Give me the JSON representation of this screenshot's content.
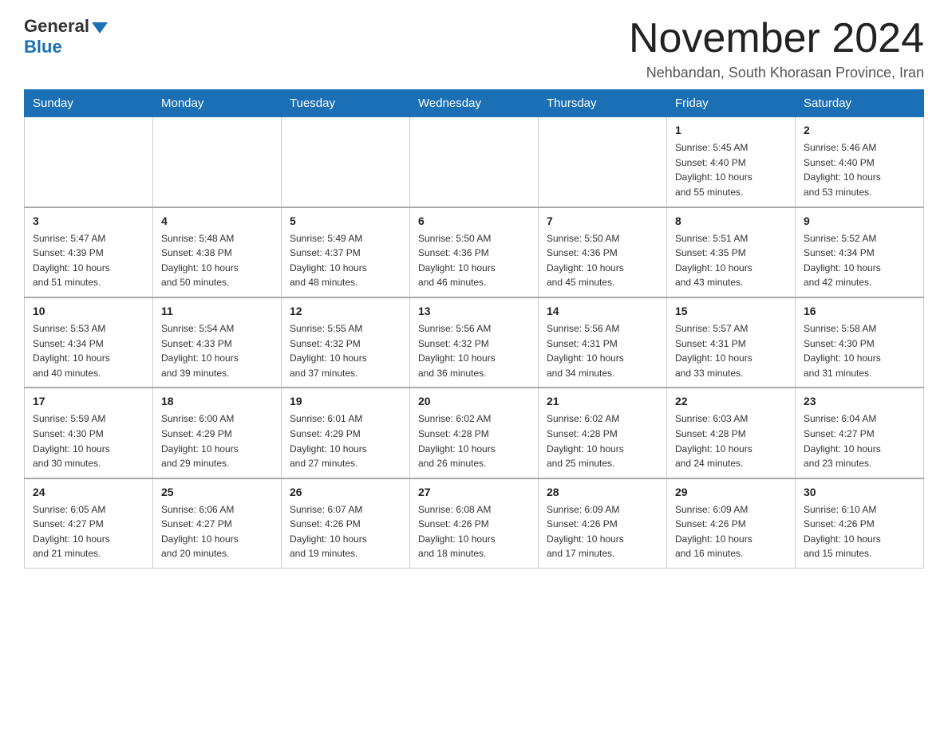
{
  "logo": {
    "general": "General",
    "blue": "Blue"
  },
  "title": "November 2024",
  "location": "Nehbandan, South Khorasan Province, Iran",
  "days_header": [
    "Sunday",
    "Monday",
    "Tuesday",
    "Wednesday",
    "Thursday",
    "Friday",
    "Saturday"
  ],
  "weeks": [
    [
      {
        "day": "",
        "info": ""
      },
      {
        "day": "",
        "info": ""
      },
      {
        "day": "",
        "info": ""
      },
      {
        "day": "",
        "info": ""
      },
      {
        "day": "",
        "info": ""
      },
      {
        "day": "1",
        "info": "Sunrise: 5:45 AM\nSunset: 4:40 PM\nDaylight: 10 hours\nand 55 minutes."
      },
      {
        "day": "2",
        "info": "Sunrise: 5:46 AM\nSunset: 4:40 PM\nDaylight: 10 hours\nand 53 minutes."
      }
    ],
    [
      {
        "day": "3",
        "info": "Sunrise: 5:47 AM\nSunset: 4:39 PM\nDaylight: 10 hours\nand 51 minutes."
      },
      {
        "day": "4",
        "info": "Sunrise: 5:48 AM\nSunset: 4:38 PM\nDaylight: 10 hours\nand 50 minutes."
      },
      {
        "day": "5",
        "info": "Sunrise: 5:49 AM\nSunset: 4:37 PM\nDaylight: 10 hours\nand 48 minutes."
      },
      {
        "day": "6",
        "info": "Sunrise: 5:50 AM\nSunset: 4:36 PM\nDaylight: 10 hours\nand 46 minutes."
      },
      {
        "day": "7",
        "info": "Sunrise: 5:50 AM\nSunset: 4:36 PM\nDaylight: 10 hours\nand 45 minutes."
      },
      {
        "day": "8",
        "info": "Sunrise: 5:51 AM\nSunset: 4:35 PM\nDaylight: 10 hours\nand 43 minutes."
      },
      {
        "day": "9",
        "info": "Sunrise: 5:52 AM\nSunset: 4:34 PM\nDaylight: 10 hours\nand 42 minutes."
      }
    ],
    [
      {
        "day": "10",
        "info": "Sunrise: 5:53 AM\nSunset: 4:34 PM\nDaylight: 10 hours\nand 40 minutes."
      },
      {
        "day": "11",
        "info": "Sunrise: 5:54 AM\nSunset: 4:33 PM\nDaylight: 10 hours\nand 39 minutes."
      },
      {
        "day": "12",
        "info": "Sunrise: 5:55 AM\nSunset: 4:32 PM\nDaylight: 10 hours\nand 37 minutes."
      },
      {
        "day": "13",
        "info": "Sunrise: 5:56 AM\nSunset: 4:32 PM\nDaylight: 10 hours\nand 36 minutes."
      },
      {
        "day": "14",
        "info": "Sunrise: 5:56 AM\nSunset: 4:31 PM\nDaylight: 10 hours\nand 34 minutes."
      },
      {
        "day": "15",
        "info": "Sunrise: 5:57 AM\nSunset: 4:31 PM\nDaylight: 10 hours\nand 33 minutes."
      },
      {
        "day": "16",
        "info": "Sunrise: 5:58 AM\nSunset: 4:30 PM\nDaylight: 10 hours\nand 31 minutes."
      }
    ],
    [
      {
        "day": "17",
        "info": "Sunrise: 5:59 AM\nSunset: 4:30 PM\nDaylight: 10 hours\nand 30 minutes."
      },
      {
        "day": "18",
        "info": "Sunrise: 6:00 AM\nSunset: 4:29 PM\nDaylight: 10 hours\nand 29 minutes."
      },
      {
        "day": "19",
        "info": "Sunrise: 6:01 AM\nSunset: 4:29 PM\nDaylight: 10 hours\nand 27 minutes."
      },
      {
        "day": "20",
        "info": "Sunrise: 6:02 AM\nSunset: 4:28 PM\nDaylight: 10 hours\nand 26 minutes."
      },
      {
        "day": "21",
        "info": "Sunrise: 6:02 AM\nSunset: 4:28 PM\nDaylight: 10 hours\nand 25 minutes."
      },
      {
        "day": "22",
        "info": "Sunrise: 6:03 AM\nSunset: 4:28 PM\nDaylight: 10 hours\nand 24 minutes."
      },
      {
        "day": "23",
        "info": "Sunrise: 6:04 AM\nSunset: 4:27 PM\nDaylight: 10 hours\nand 23 minutes."
      }
    ],
    [
      {
        "day": "24",
        "info": "Sunrise: 6:05 AM\nSunset: 4:27 PM\nDaylight: 10 hours\nand 21 minutes."
      },
      {
        "day": "25",
        "info": "Sunrise: 6:06 AM\nSunset: 4:27 PM\nDaylight: 10 hours\nand 20 minutes."
      },
      {
        "day": "26",
        "info": "Sunrise: 6:07 AM\nSunset: 4:26 PM\nDaylight: 10 hours\nand 19 minutes."
      },
      {
        "day": "27",
        "info": "Sunrise: 6:08 AM\nSunset: 4:26 PM\nDaylight: 10 hours\nand 18 minutes."
      },
      {
        "day": "28",
        "info": "Sunrise: 6:09 AM\nSunset: 4:26 PM\nDaylight: 10 hours\nand 17 minutes."
      },
      {
        "day": "29",
        "info": "Sunrise: 6:09 AM\nSunset: 4:26 PM\nDaylight: 10 hours\nand 16 minutes."
      },
      {
        "day": "30",
        "info": "Sunrise: 6:10 AM\nSunset: 4:26 PM\nDaylight: 10 hours\nand 15 minutes."
      }
    ]
  ]
}
